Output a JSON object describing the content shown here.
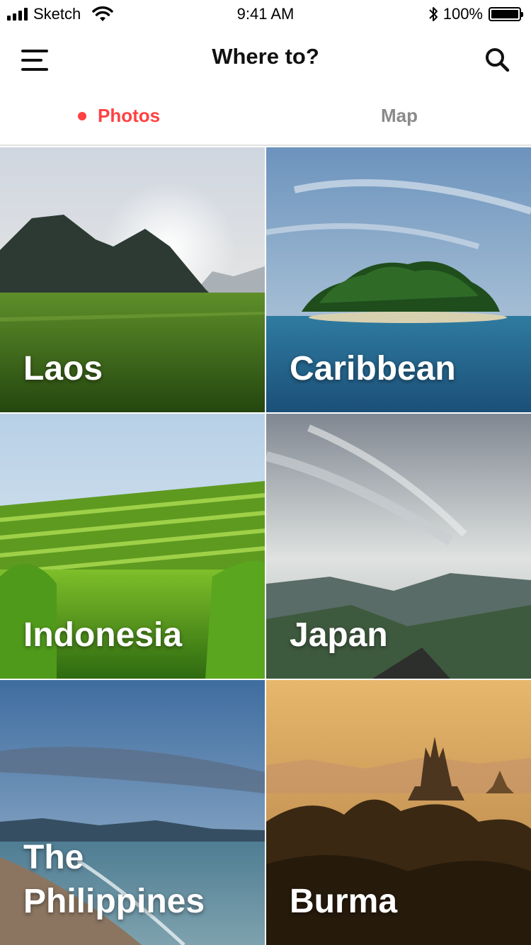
{
  "status_bar": {
    "carrier": "Sketch",
    "time": "9:41 AM",
    "battery": "100%",
    "icons": [
      "signal-icon",
      "wifi-icon",
      "bluetooth-icon",
      "battery-icon"
    ]
  },
  "nav": {
    "title": "Where to?",
    "left_icon": "menu-icon",
    "right_icon": "search-icon"
  },
  "tabs": [
    {
      "label": "Photos",
      "active": true
    },
    {
      "label": "Map",
      "active": false
    }
  ],
  "accent_color": "#ff4141",
  "destinations": [
    {
      "name": "Laos"
    },
    {
      "name": "Caribbean"
    },
    {
      "name": "Indonesia"
    },
    {
      "name": "Japan"
    },
    {
      "name": "The Philippines"
    },
    {
      "name": "Burma"
    }
  ]
}
